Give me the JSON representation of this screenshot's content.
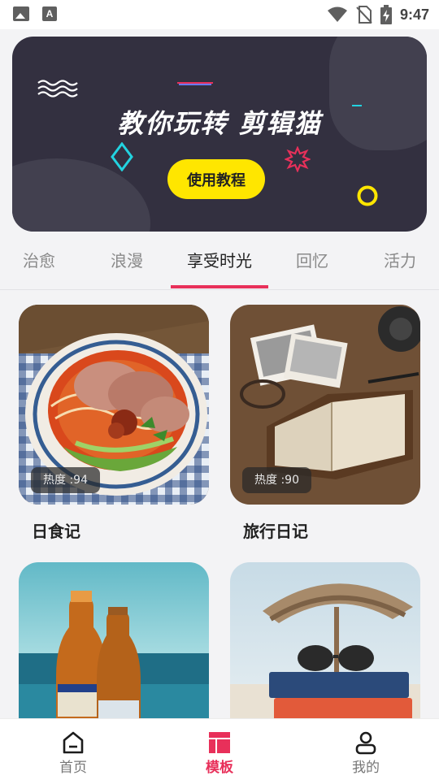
{
  "status_bar": {
    "time": "9:47",
    "left_icons": [
      "image-icon",
      "font-a-icon"
    ],
    "right_icons": [
      "wifi-icon",
      "no-sim-icon",
      "battery-charging-icon"
    ]
  },
  "banner": {
    "title": "教你玩转  剪辑猫",
    "button_label": "使用教程",
    "accent_colors": {
      "background": "#333040",
      "button": "#ffe600",
      "diamond": "#22d3e0",
      "star": "#e8305a",
      "ring": "#ffe600"
    }
  },
  "tabs": {
    "items": [
      {
        "label": "治愈"
      },
      {
        "label": "浪漫"
      },
      {
        "label": "享受时光"
      },
      {
        "label": "回忆"
      },
      {
        "label": "活力"
      }
    ],
    "active_index": 2,
    "active_color": "#e8305a"
  },
  "cards": [
    {
      "title": "日食记",
      "heat": "热度 :94",
      "image": "noodle-bowl-photo"
    },
    {
      "title": "旅行日记",
      "heat": "热度 :90",
      "image": "notebook-photos-photo"
    },
    {
      "title": "",
      "heat": "",
      "image": "beer-bottles-beach-photo"
    },
    {
      "title": "",
      "heat": "",
      "image": "books-sunglasses-beach-photo"
    }
  ],
  "bottom_nav": {
    "items": [
      {
        "label": "首页",
        "icon": "home-icon"
      },
      {
        "label": "模板",
        "icon": "template-icon"
      },
      {
        "label": "我的",
        "icon": "profile-icon"
      }
    ],
    "active_index": 1
  }
}
